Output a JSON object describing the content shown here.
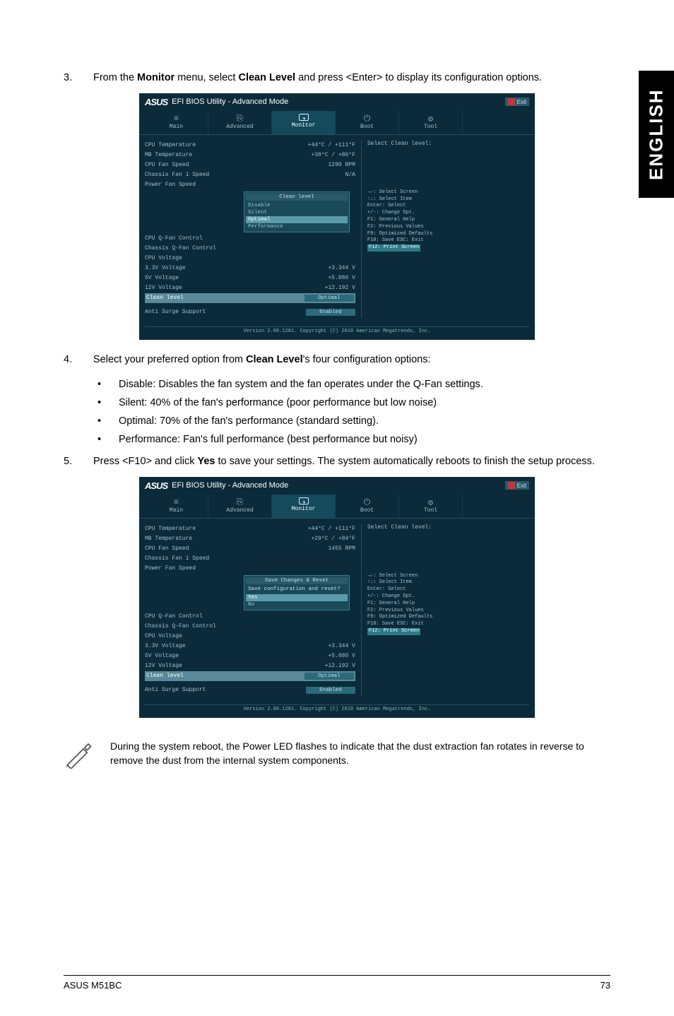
{
  "side_tab": "ENGLISH",
  "step3": {
    "num": "3.",
    "prefix": "From the ",
    "b1": "Monitor",
    "mid1": " menu, select ",
    "b2": "Clean Level",
    "suffix": " and press <Enter> to display its configuration options."
  },
  "step4": {
    "num": "4.",
    "prefix": "Select your preferred option from ",
    "b1": "Clean Level",
    "suffix": "'s four configuration options:"
  },
  "bullets": [
    "Disable: Disables the fan system and the fan operates under the Q-Fan settings.",
    "Silent: 40% of the fan's performance (poor performance but low noise)",
    "Optimal: 70% of the fan's performance (standard setting).",
    "Performance: Fan's full performance (best performance but noisy)"
  ],
  "step5": {
    "num": "5.",
    "prefix": "Press <F10> and click ",
    "b1": "Yes",
    "suffix": " to save your settings. The system automatically reboots to finish the setup process."
  },
  "note": "During the system reboot, the Power LED flashes to indicate that the dust extraction fan rotates in reverse to remove the dust from the internal system components.",
  "footer_left": "ASUS M51BC",
  "footer_right": "73",
  "bios": {
    "brand": "ASUS",
    "title_rest": " EFI BIOS Utility - Advanced Mode",
    "exit": "Exit",
    "tabs": [
      "Main",
      "Advanced",
      "Monitor",
      "Boot",
      "Tool"
    ],
    "rows": [
      {
        "label": "CPU Temperature",
        "val": "+44°C / +111°F"
      },
      {
        "label": "MB Temperature",
        "val": "+30°C / +86°F"
      },
      {
        "label": "CPU Fan Speed",
        "val": "1290 RPM"
      },
      {
        "label": "Chassis Fan 1 Speed",
        "val": "N/A"
      },
      {
        "label": "Power Fan Speed",
        "val": ""
      },
      {
        "label": "CPU Q-Fan Control",
        "val": ""
      },
      {
        "label": "Chassis Q-Fan Control",
        "val": ""
      },
      {
        "label": "CPU Voltage",
        "val": ""
      },
      {
        "label": "3.3V Voltage",
        "val": "+3.344 V"
      },
      {
        "label": "5V Voltage",
        "val": "+5.080 V"
      },
      {
        "label": "12V Voltage",
        "val": "+12.192 V"
      },
      {
        "label": "Clean level",
        "val": "Optimal",
        "sel": true
      },
      {
        "label": "Anti Surge Support",
        "val": "Enabled"
      }
    ],
    "rows2": [
      {
        "label": "CPU Temperature",
        "val": "+44°C / +111°F"
      },
      {
        "label": "MB Temperature",
        "val": "+29°C / +84°F"
      },
      {
        "label": "CPU Fan Speed",
        "val": "1455 RPM"
      },
      {
        "label": "Chassis Fan 1 Speed",
        "val": ""
      },
      {
        "label": "Power Fan Speed",
        "val": ""
      },
      {
        "label": "CPU Q-Fan Control",
        "val": ""
      },
      {
        "label": "Chassis Q-Fan Control",
        "val": ""
      },
      {
        "label": "CPU Voltage",
        "val": ""
      },
      {
        "label": "3.3V Voltage",
        "val": "+3.344 V"
      },
      {
        "label": "5V Voltage",
        "val": "+5.080 V"
      },
      {
        "label": "12V Voltage",
        "val": "+12.192 V"
      },
      {
        "label": "Clean level",
        "val": "Optimal",
        "sel": true
      },
      {
        "label": "Anti Surge Support",
        "val": "Enabled"
      }
    ],
    "dropdown": {
      "title": "Clean level",
      "items": [
        "Disable",
        "Silent",
        "Optimal",
        "Performance"
      ],
      "selected": "Optimal"
    },
    "savebox": {
      "title": "Save Changes & Reset",
      "prompt": "Save configuration and reset?",
      "items": [
        "Yes",
        "No"
      ],
      "selected": "Yes"
    },
    "help_title": "Select Clean level:",
    "help_keys": [
      "→←: Select Screen",
      "↑↓: Select Item",
      "Enter: Select",
      "+/-: Change Opt.",
      "F1: General Help",
      "F2: Previous Values",
      "F9: Optimized Defaults",
      "F10: Save  ESC: Exit",
      "F12: Print Screen"
    ],
    "footer": "Version 2.00.1201. Copyright (C) 2010 American Megatrends, Inc."
  }
}
